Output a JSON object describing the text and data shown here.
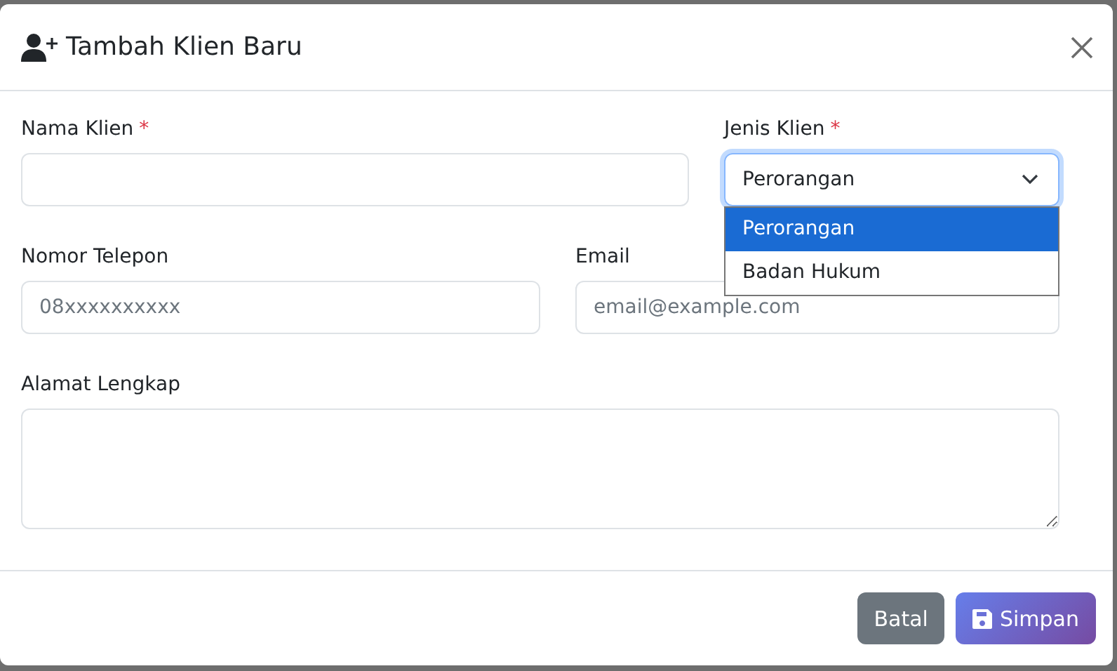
{
  "modal": {
    "title": "Tambah Klien Baru"
  },
  "fields": [
    {
      "kind": "text",
      "label": "Nama Klien",
      "required_mark": "*"
    },
    {
      "kind": "select",
      "label": "Jenis Klien",
      "required_mark": "*",
      "value": "Perorangan",
      "expanded": true,
      "focused": true,
      "options": [
        {
          "label": "Perorangan",
          "selected": true
        },
        {
          "label": "Badan Hukum",
          "selected": false
        }
      ]
    },
    {
      "kind": "text",
      "label": "Nomor Telepon",
      "placeholder": "08xxxxxxxxxx"
    },
    {
      "kind": "text",
      "label": "Email",
      "placeholder": "email@example.com"
    },
    {
      "kind": "textarea",
      "label": "Alamat Lengkap"
    }
  ],
  "buttons": [
    {
      "kind": "secondary",
      "label": "Batal"
    },
    {
      "kind": "primary",
      "label": "Simpan"
    }
  ]
}
